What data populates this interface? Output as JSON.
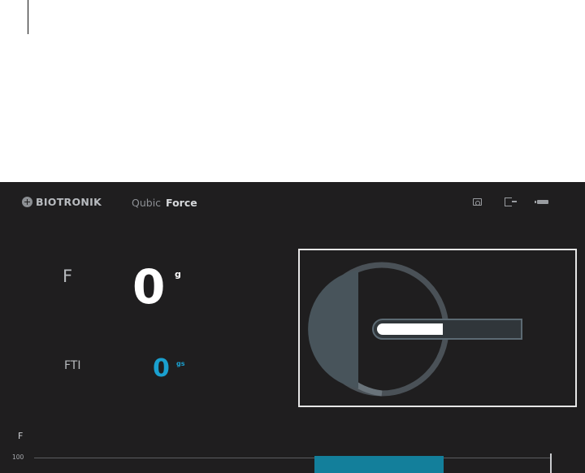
{
  "header": {
    "brand": "BIOTRONIK",
    "product_prefix": "Qubic",
    "product_name": "Force",
    "icons": [
      "camera-icon",
      "exit-icon",
      "battery-icon"
    ]
  },
  "readouts": {
    "force": {
      "label": "F",
      "value": "0",
      "unit": "g"
    },
    "fti": {
      "label": "FTI",
      "value": "0",
      "unit": "gs"
    }
  },
  "colors": {
    "background": "#1f1e1f",
    "accent_blue": "#1aa0cf",
    "bar_teal": "#137f9b",
    "panel_border": "#e6e6e6"
  },
  "chart": {
    "label": "F",
    "tick": "100"
  },
  "chart_data": {
    "type": "bar",
    "ylabel": "F",
    "yticks": [
      100
    ],
    "bars": [
      {
        "value": 100
      }
    ]
  }
}
